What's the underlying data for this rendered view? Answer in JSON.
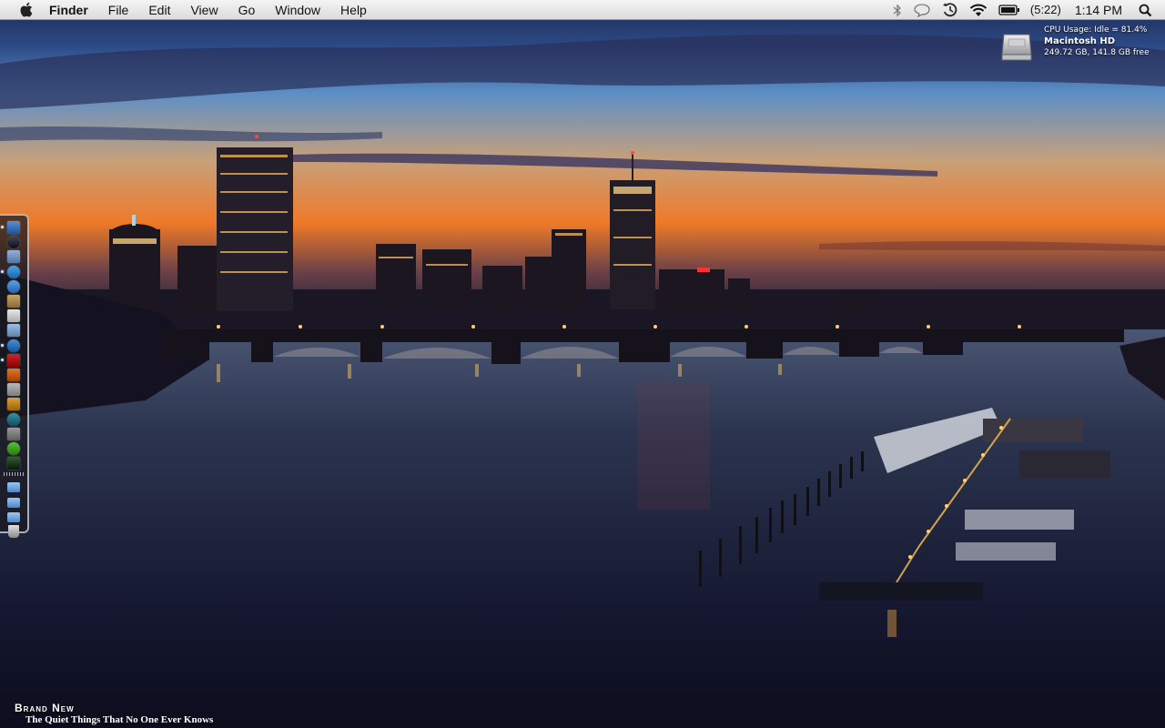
{
  "menubar": {
    "apple_icon": "apple-icon",
    "app_name": "Finder",
    "menus": [
      "File",
      "Edit",
      "View",
      "Go",
      "Window",
      "Help"
    ],
    "status_icons": [
      "bluetooth-icon",
      "speech-bubble-icon",
      "time-machine-icon",
      "wifi-icon",
      "battery-icon"
    ],
    "battery_time": "(5:22)",
    "clock": "1:14 PM",
    "search_icon": "spotlight-search-icon"
  },
  "desktop": {
    "disk_icon": "hard-drive-icon",
    "stats": {
      "cpu": "CPU Usage:  Idle = 81.4%",
      "disk_name": "Macintosh HD",
      "disk_free": "249.72 GB, 141.8 GB free"
    },
    "wallpaper": "city-skyline-at-dusk-river-bridge-marina",
    "now_playing": {
      "artist": "Brand New",
      "track": "The Quiet Things That No One Ever Knows"
    }
  },
  "dock": {
    "orientation": "left",
    "apps": [
      {
        "name": "finder-icon",
        "color": "#5a8fd8",
        "running": true
      },
      {
        "name": "dashboard-icon",
        "color": "#444a55",
        "running": false
      },
      {
        "name": "mail-icon",
        "color": "#8fb2e0",
        "running": false
      },
      {
        "name": "safari-icon",
        "color": "#4da3e6",
        "running": true
      },
      {
        "name": "ichat-icon",
        "color": "#5fa0e8",
        "running": false
      },
      {
        "name": "address-book-icon",
        "color": "#c8a56a",
        "running": false
      },
      {
        "name": "ical-icon",
        "color": "#e8e8e8",
        "running": false
      },
      {
        "name": "preview-icon",
        "color": "#9ac0e8",
        "running": false
      },
      {
        "name": "itunes-icon",
        "color": "#4d8fd8",
        "running": true
      },
      {
        "name": "photo-booth-icon",
        "color": "#c8262a",
        "running": true
      },
      {
        "name": "iphoto-icon",
        "color": "#e07a2a",
        "running": false
      },
      {
        "name": "imovie-icon",
        "color": "#b9b9b9",
        "running": false
      },
      {
        "name": "garageband-icon",
        "color": "#d9a040",
        "running": false
      },
      {
        "name": "time-machine-icon",
        "color": "#3f8f9f",
        "running": false
      },
      {
        "name": "system-preferences-icon",
        "color": "#9a9a9a",
        "running": false
      },
      {
        "name": "green-app-icon",
        "color": "#5cbf3a",
        "running": false
      },
      {
        "name": "terminal-icon",
        "color": "#3a5a3a",
        "running": false
      }
    ],
    "folders": [
      {
        "name": "applications-folder-icon",
        "color": "#6fa6dc"
      },
      {
        "name": "documents-folder-icon",
        "color": "#6fa6dc"
      },
      {
        "name": "downloads-folder-icon",
        "color": "#6fa6dc"
      },
      {
        "name": "trash-icon",
        "color": "#c8c8c8"
      }
    ]
  }
}
